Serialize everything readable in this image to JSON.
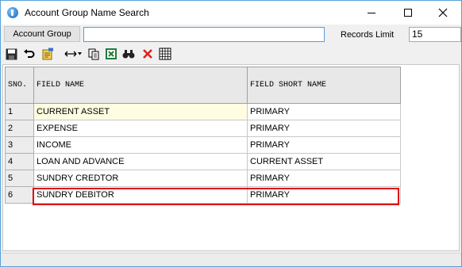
{
  "window": {
    "title": "Account Group Name Search"
  },
  "search": {
    "group_label": "Account Group",
    "group_value": "",
    "limit_label": "Records Limit",
    "limit_value": "15"
  },
  "toolbar": {
    "icons": [
      "save-icon",
      "undo-icon",
      "edit-note-icon",
      "move-arrows-icon",
      "copy-icon",
      "excel-icon",
      "find-icon",
      "delete-icon",
      "grid-icon"
    ]
  },
  "grid": {
    "columns": [
      "SNO.",
      "FIELD NAME",
      "FIELD SHORT NAME"
    ],
    "rows": [
      {
        "sno": "1",
        "name": "CURRENT ASSET",
        "short": "PRIMARY"
      },
      {
        "sno": "2",
        "name": "EXPENSE",
        "short": "PRIMARY"
      },
      {
        "sno": "3",
        "name": "INCOME",
        "short": "PRIMARY"
      },
      {
        "sno": "4",
        "name": "LOAN AND ADVANCE",
        "short": "CURRENT ASSET"
      },
      {
        "sno": "5",
        "name": "SUNDRY CREDTOR",
        "short": "PRIMARY"
      },
      {
        "sno": "6",
        "name": "SUNDRY DEBITOR",
        "short": "PRIMARY"
      }
    ],
    "selected_row": 6
  },
  "colors": {
    "selection_border": "#e00000",
    "highlight_cell": "#fffde1",
    "input_focus_border": "#5b9bd5"
  }
}
